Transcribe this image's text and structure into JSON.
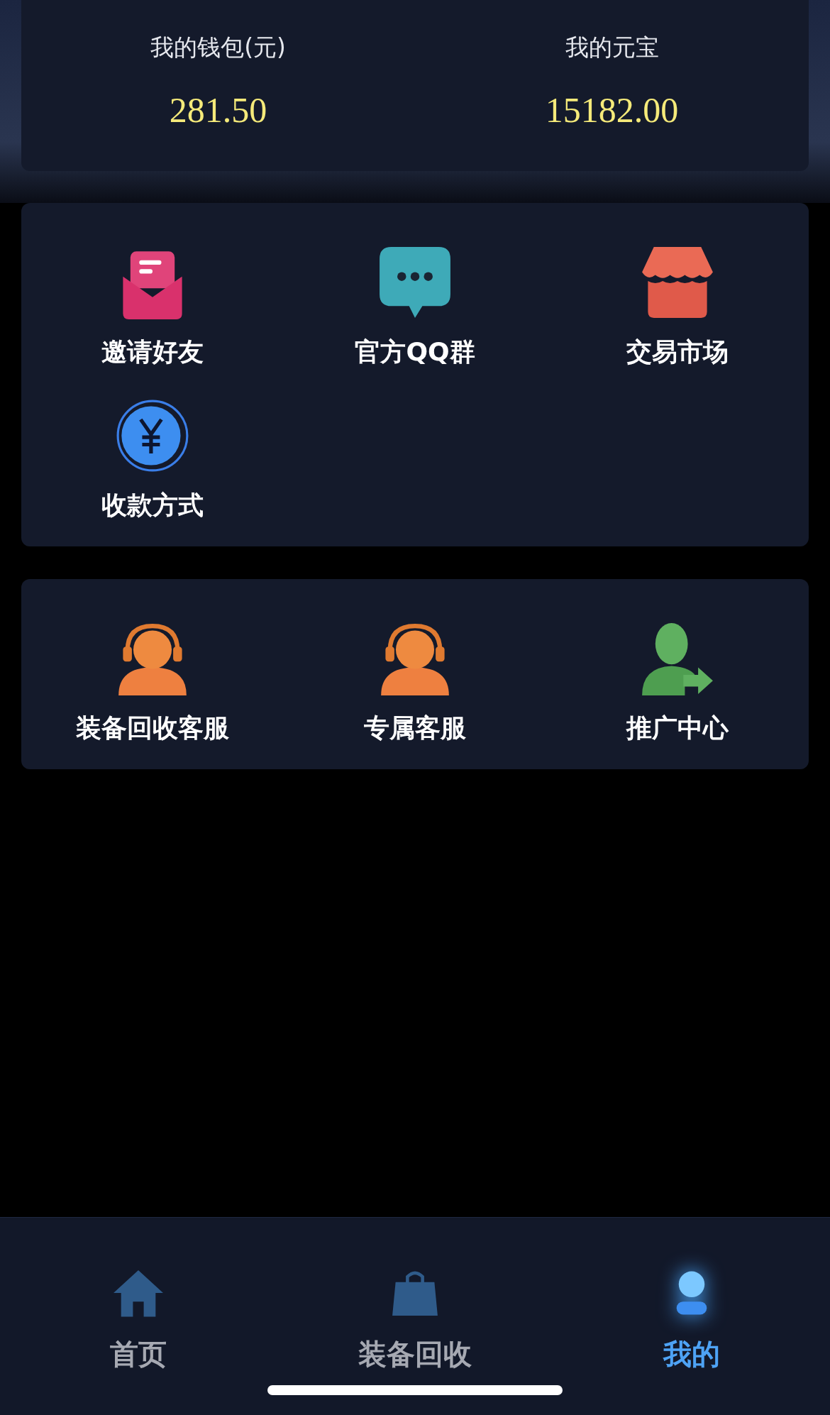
{
  "wallet": [
    {
      "label": "我的钱包(元)",
      "value": "281.50"
    },
    {
      "label": "我的元宝",
      "value": "15182.00"
    }
  ],
  "menus": [
    {
      "items": [
        {
          "kind": "invite",
          "label": "邀请好友"
        },
        {
          "kind": "chat",
          "label": "官方QQ群"
        },
        {
          "kind": "market",
          "label": "交易市场"
        },
        {
          "kind": "payment",
          "label": "收款方式"
        }
      ]
    },
    {
      "items": [
        {
          "kind": "service",
          "label": "装备回收客服"
        },
        {
          "kind": "service",
          "label": "专属客服"
        },
        {
          "kind": "promote",
          "label": "推广中心"
        }
      ]
    }
  ],
  "tabs": [
    {
      "kind": "home",
      "label": "首页",
      "selected": false
    },
    {
      "kind": "bag",
      "label": "装备回收",
      "selected": false
    },
    {
      "kind": "user",
      "label": "我的",
      "selected": true
    }
  ]
}
